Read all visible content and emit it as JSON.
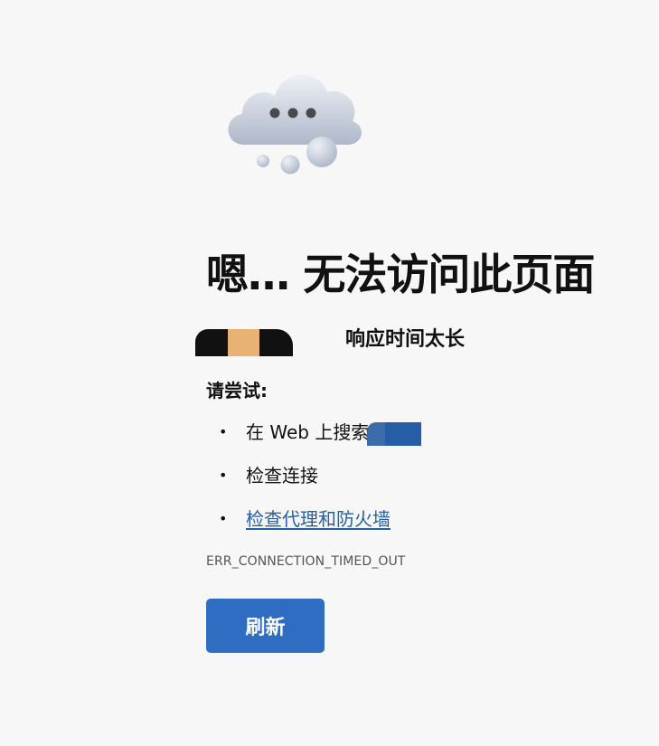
{
  "illustration": {
    "icon": "cloud-ellipsis-icon"
  },
  "heading": "嗯… 无法访问此页面",
  "subline": {
    "text": "响应时间太长"
  },
  "try_title": "请尝试:",
  "suggestions": [
    {
      "label": "在 Web 上搜索"
    },
    {
      "label": "检查连接"
    },
    {
      "label": "检查代理和防火墙",
      "is_link": true
    }
  ],
  "error_code": "ERR_CONNECTION_TIMED_OUT",
  "refresh_label": "刷新",
  "colors": {
    "background": "#f7f7f7",
    "accent": "#2f6dc2",
    "link": "#245fa8"
  }
}
